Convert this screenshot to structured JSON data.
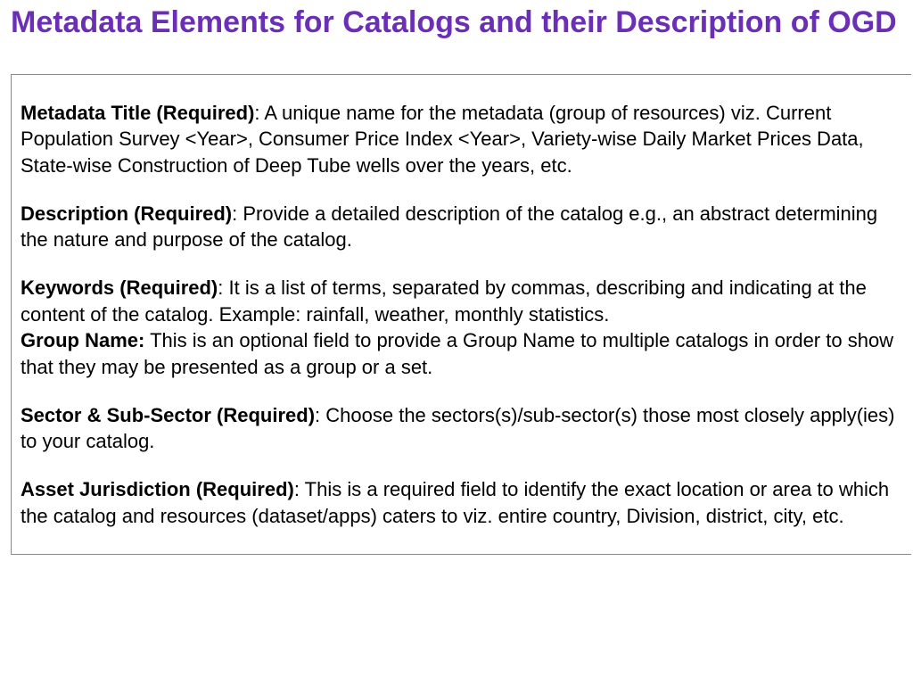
{
  "title": "Metadata Elements for Catalogs and their Description of OGD",
  "items": [
    {
      "label": "Metadata Title (Required)",
      "body": ": A unique name for the metadata (group of resources) viz. Current Population Survey <Year>, Consumer Price Index <Year>, Variety-wise Daily Market Prices Data, State-wise Construction of Deep Tube wells over the years, etc."
    },
    {
      "label": "Description (Required)",
      "body": ": Provide a  detailed description of the catalog e.g., an abstract determining the nature and purpose of the catalog."
    },
    {
      "label": "Keywords (Required)",
      "body": ": It is a list of terms, separated by commas, describing and indicating at the content of the catalog. Example: rainfall, weather, monthly statistics."
    },
    {
      "label": "Group Name:",
      "body": " This is an optional field to provide a Group Name to multiple catalogs in order to show that they may be presented as a group or a set."
    },
    {
      "label": "Sector & Sub-Sector (Required)",
      "body": ": Choose the sectors(s)/sub-sector(s) those most closely apply(ies) to your catalog."
    },
    {
      "label": "Asset Jurisdiction (Required)",
      "body": ": This is a required field to identify the exact location or area to which the catalog and resources (dataset/apps) caters to viz. entire country, Division, district, city, etc."
    }
  ]
}
